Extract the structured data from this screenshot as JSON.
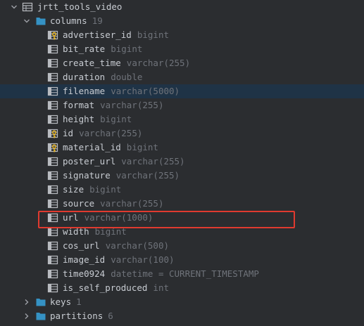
{
  "tree": {
    "table": {
      "name": "jrtt_tools_video",
      "expanded": true,
      "icon": "table-icon"
    },
    "columns_folder": {
      "label": "columns",
      "count": "19",
      "expanded": true,
      "icon": "folder-icon"
    },
    "columns": [
      {
        "name": "advertiser_id",
        "type": "bigint",
        "icon": "key-column-icon",
        "selected": false
      },
      {
        "name": "bit_rate",
        "type": "bigint",
        "icon": "column-icon",
        "selected": false
      },
      {
        "name": "create_time",
        "type": "varchar(255)",
        "icon": "column-icon",
        "selected": false
      },
      {
        "name": "duration",
        "type": "double",
        "icon": "column-icon",
        "selected": false
      },
      {
        "name": "filename",
        "type": "varchar(5000)",
        "icon": "column-icon",
        "selected": true
      },
      {
        "name": "format",
        "type": "varchar(255)",
        "icon": "column-icon",
        "selected": false
      },
      {
        "name": "height",
        "type": "bigint",
        "icon": "column-icon",
        "selected": false
      },
      {
        "name": "id",
        "type": "varchar(255)",
        "icon": "key-column-icon",
        "selected": false
      },
      {
        "name": "material_id",
        "type": "bigint",
        "icon": "key-column-icon",
        "selected": false
      },
      {
        "name": "poster_url",
        "type": "varchar(255)",
        "icon": "column-icon",
        "selected": false
      },
      {
        "name": "signature",
        "type": "varchar(255)",
        "icon": "column-icon",
        "selected": false
      },
      {
        "name": "size",
        "type": "bigint",
        "icon": "column-icon",
        "selected": false
      },
      {
        "name": "source",
        "type": "varchar(255)",
        "icon": "column-icon",
        "selected": false
      },
      {
        "name": "url",
        "type": "varchar(1000)",
        "icon": "column-icon",
        "selected": false
      },
      {
        "name": "width",
        "type": "bigint",
        "icon": "column-icon",
        "selected": false
      },
      {
        "name": "cos_url",
        "type": "varchar(500)",
        "icon": "column-icon",
        "selected": false
      },
      {
        "name": "image_id",
        "type": "varchar(100)",
        "icon": "column-icon",
        "selected": false
      },
      {
        "name": "time0924",
        "type": "datetime = CURRENT_TIMESTAMP",
        "icon": "column-icon",
        "selected": false
      },
      {
        "name": "is_self_produced",
        "type": "int",
        "icon": "column-icon",
        "selected": false
      }
    ],
    "folders": [
      {
        "label": "keys",
        "count": "1",
        "expanded": false,
        "icon": "folder-icon"
      },
      {
        "label": "partitions",
        "count": "6",
        "expanded": false,
        "icon": "folder-icon"
      }
    ]
  },
  "annotation": {
    "color": "#e03a2f",
    "highlighted_column": "url"
  },
  "colors": {
    "background": "#2b2d30",
    "selection": "#1f3346",
    "text": "#c8ccd2",
    "muted": "#6f737a",
    "folder": "#3592c4"
  }
}
